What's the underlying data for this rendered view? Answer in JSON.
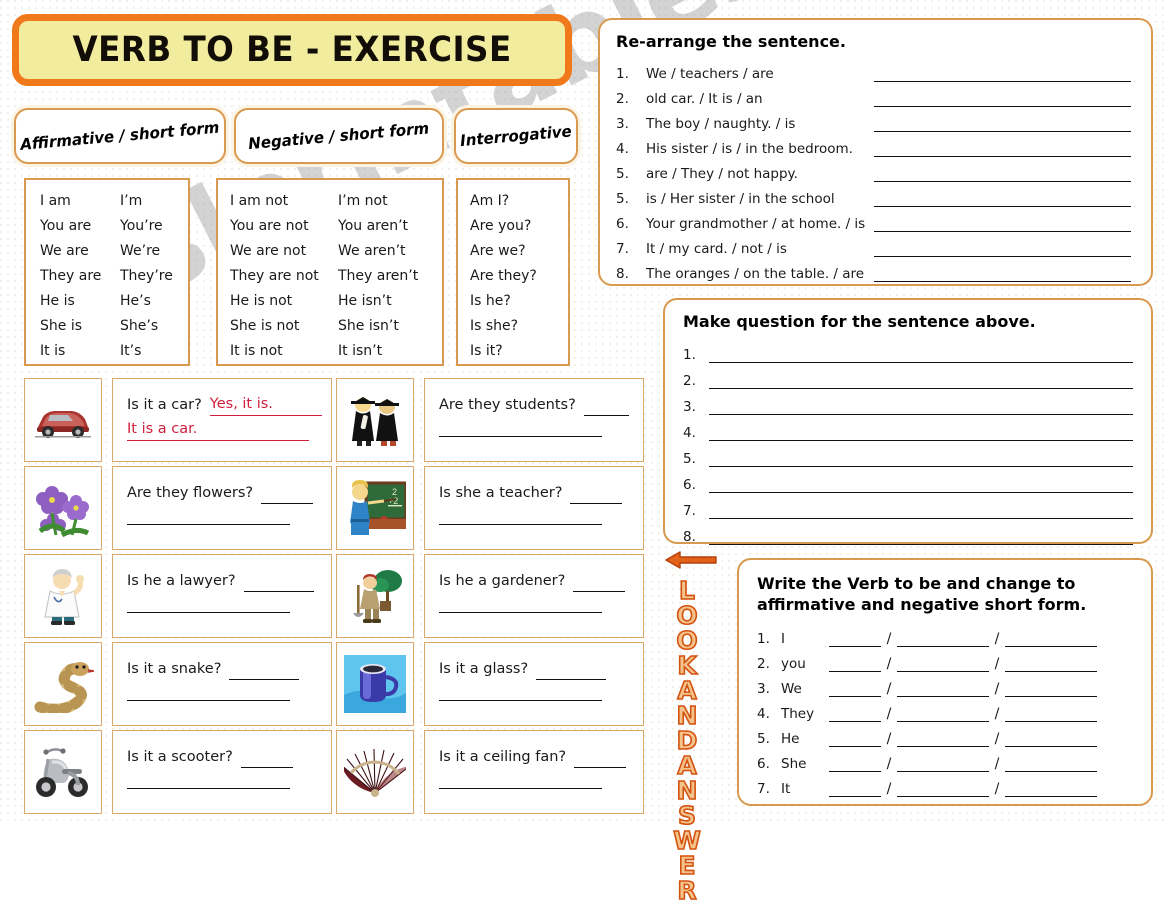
{
  "title": "VERB TO BE - EXERCISE",
  "colors": {
    "accent_orange": "#f07a1b",
    "title_fill": "#f2ec9e",
    "card_border": "#d89a4e",
    "answer_red": "#d01f3c",
    "look_fill": "#f4c38c",
    "look_stroke": "#d4520f"
  },
  "watermark": "eslprintables.com",
  "chips": {
    "affirmative": "Affirmative / short form",
    "negative": "Negative / short form",
    "interrogative": "Interrogative"
  },
  "conjugation": {
    "affirmative": [
      {
        "long": "I am",
        "short": "I’m"
      },
      {
        "long": "You are",
        "short": "You’re"
      },
      {
        "long": "We are",
        "short": "We’re"
      },
      {
        "long": "They are",
        "short": "They’re"
      },
      {
        "long": "He is",
        "short": "He’s"
      },
      {
        "long": "She is",
        "short": "She’s"
      },
      {
        "long": "It is",
        "short": "It’s"
      }
    ],
    "negative": [
      {
        "long": "I am not",
        "short": "I’m not"
      },
      {
        "long": "You are not",
        "short": "You aren’t"
      },
      {
        "long": "We are not",
        "short": "We aren’t"
      },
      {
        "long": "They are not",
        "short": "They aren’t"
      },
      {
        "long": "He is not",
        "short": "He isn’t"
      },
      {
        "long": "She is not",
        "short": "She isn’t"
      },
      {
        "long": "It is not",
        "short": "It isn’t"
      }
    ],
    "interrogative": [
      {
        "long": "Am I?"
      },
      {
        "long": "Are you?"
      },
      {
        "long": "Are we?"
      },
      {
        "long": "Are they?"
      },
      {
        "long": "Is he?"
      },
      {
        "long": "Is she?"
      },
      {
        "long": "Is it?"
      }
    ]
  },
  "picture_questions": [
    {
      "icon": "car-icon",
      "question": "Is it a car?",
      "example_answer_1": "Yes, it is.",
      "example_answer_2": "It is a car.",
      "is_example": true
    },
    {
      "icon": "graduates-icon",
      "question": "Are they students?",
      "example_answer_1": "",
      "example_answer_2": "",
      "is_example": false
    },
    {
      "icon": "flowers-icon",
      "question": "Are they flowers?",
      "example_answer_1": "",
      "example_answer_2": "",
      "is_example": false
    },
    {
      "icon": "teacher-icon",
      "question": "Is she a teacher?",
      "example_answer_1": "",
      "example_answer_2": "",
      "is_example": false
    },
    {
      "icon": "doctor-icon",
      "question": "Is he a lawyer?",
      "example_answer_1": "",
      "example_answer_2": "",
      "is_example": false
    },
    {
      "icon": "gardener-icon",
      "question": "Is he a gardener?",
      "example_answer_1": "",
      "example_answer_2": "",
      "is_example": false
    },
    {
      "icon": "snake-icon",
      "question": "Is it a snake?",
      "example_answer_1": "",
      "example_answer_2": "",
      "is_example": false
    },
    {
      "icon": "mug-icon",
      "question": "Is it a glass?",
      "example_answer_1": "",
      "example_answer_2": "",
      "is_example": false
    },
    {
      "icon": "scooter-icon",
      "question": "Is it a scooter?",
      "example_answer_1": "",
      "example_answer_2": "",
      "is_example": false
    },
    {
      "icon": "fan-icon",
      "question": "Is it a ceiling fan?",
      "example_answer_1": "",
      "example_answer_2": "",
      "is_example": false
    }
  ],
  "rearrange": {
    "title": "Re-arrange the sentence.",
    "items": [
      {
        "num": "1.",
        "text": "We / teachers / are"
      },
      {
        "num": "2.",
        "text": "old car. / It is / an"
      },
      {
        "num": "3.",
        "text": "The boy / naughty. / is"
      },
      {
        "num": "4.",
        "text": "His sister / is / in the bedroom."
      },
      {
        "num": "5.",
        "text": "are / They / not happy."
      },
      {
        "num": "5.",
        "text": "is / Her sister / in the school"
      },
      {
        "num": "6.",
        "text": "Your grandmother / at home. / is"
      },
      {
        "num": "7.",
        "text": "It / my card. / not / is"
      },
      {
        "num": "8.",
        "text": "The oranges / on the table. / are"
      }
    ]
  },
  "make_question": {
    "title": "Make question for the sentence above.",
    "numbers": [
      "1.",
      "2.",
      "3.",
      "4.",
      "5.",
      "6.",
      "7.",
      "8."
    ]
  },
  "look_and_answer": {
    "label": "LOOK AND ANSWER",
    "arrow": "left-arrow-icon"
  },
  "write_verb": {
    "title_line_1": "Write the Verb to be and change to",
    "title_line_2": "affirmative and negative short form.",
    "separator": "/",
    "rows": [
      {
        "num": "1.",
        "pronoun": "I"
      },
      {
        "num": "2.",
        "pronoun": "you"
      },
      {
        "num": "3.",
        "pronoun": "We"
      },
      {
        "num": "4.",
        "pronoun": "They"
      },
      {
        "num": "5.",
        "pronoun": "He"
      },
      {
        "num": "6.",
        "pronoun": "She"
      },
      {
        "num": "7.",
        "pronoun": "It"
      }
    ]
  }
}
